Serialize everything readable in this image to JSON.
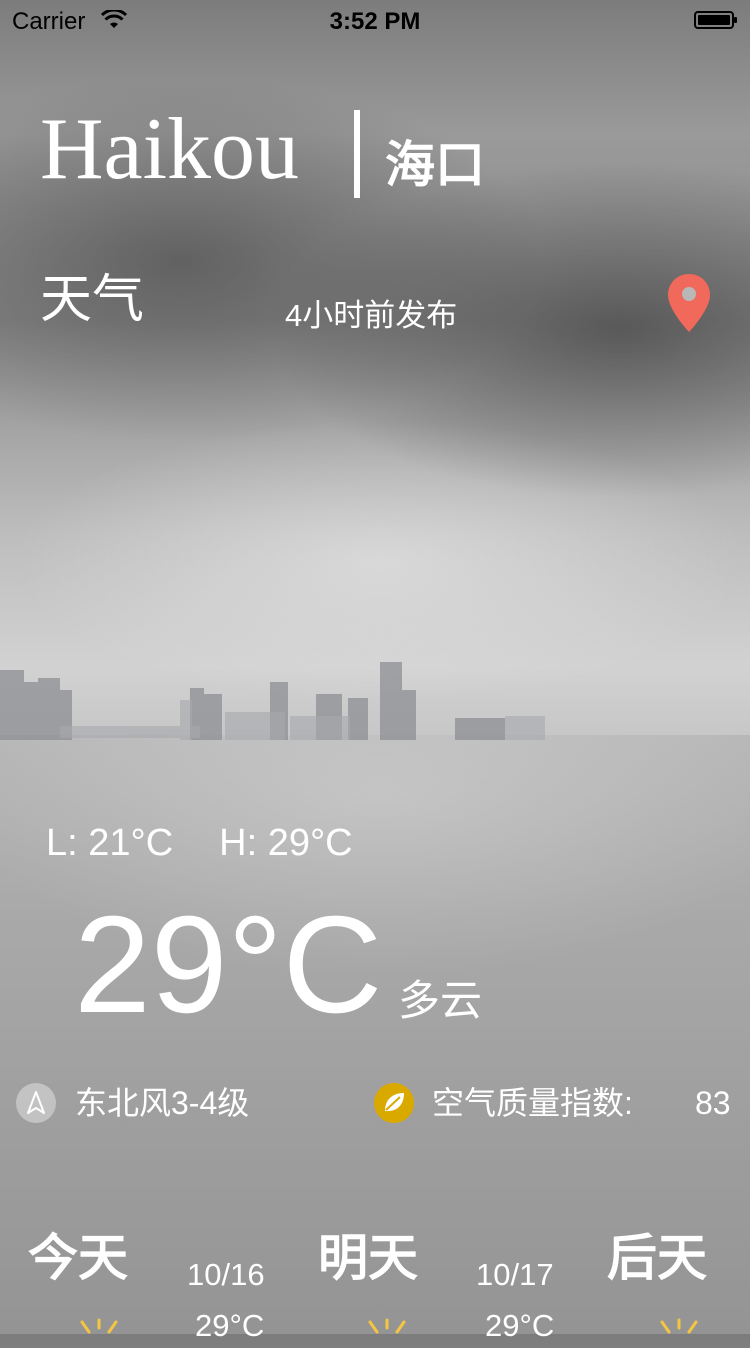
{
  "status_bar": {
    "carrier": "Carrier",
    "time": "3:52 PM"
  },
  "city": {
    "name_en": "Haikou",
    "name_cn": "海口"
  },
  "weather_label": "天气",
  "publish_time": "4小时前发布",
  "current": {
    "low": "L: 21°C",
    "high": "H: 29°C",
    "temperature": "29°C",
    "condition": "多云"
  },
  "wind": {
    "icon": "wind-direction-icon",
    "text": "东北风3-4级"
  },
  "air_quality": {
    "icon": "leaf-icon",
    "label": "空气质量指数:",
    "value": "83"
  },
  "forecast": {
    "days": [
      "今天",
      "明天",
      "后天"
    ],
    "dates": [
      "10/16",
      "10/17"
    ],
    "temps": [
      "29°C",
      "29°C"
    ],
    "icon": "sun-icon"
  },
  "colors": {
    "pin": "#f0695a",
    "aqi_icon_bg": "#d9a900",
    "sun": "#f5c542"
  }
}
